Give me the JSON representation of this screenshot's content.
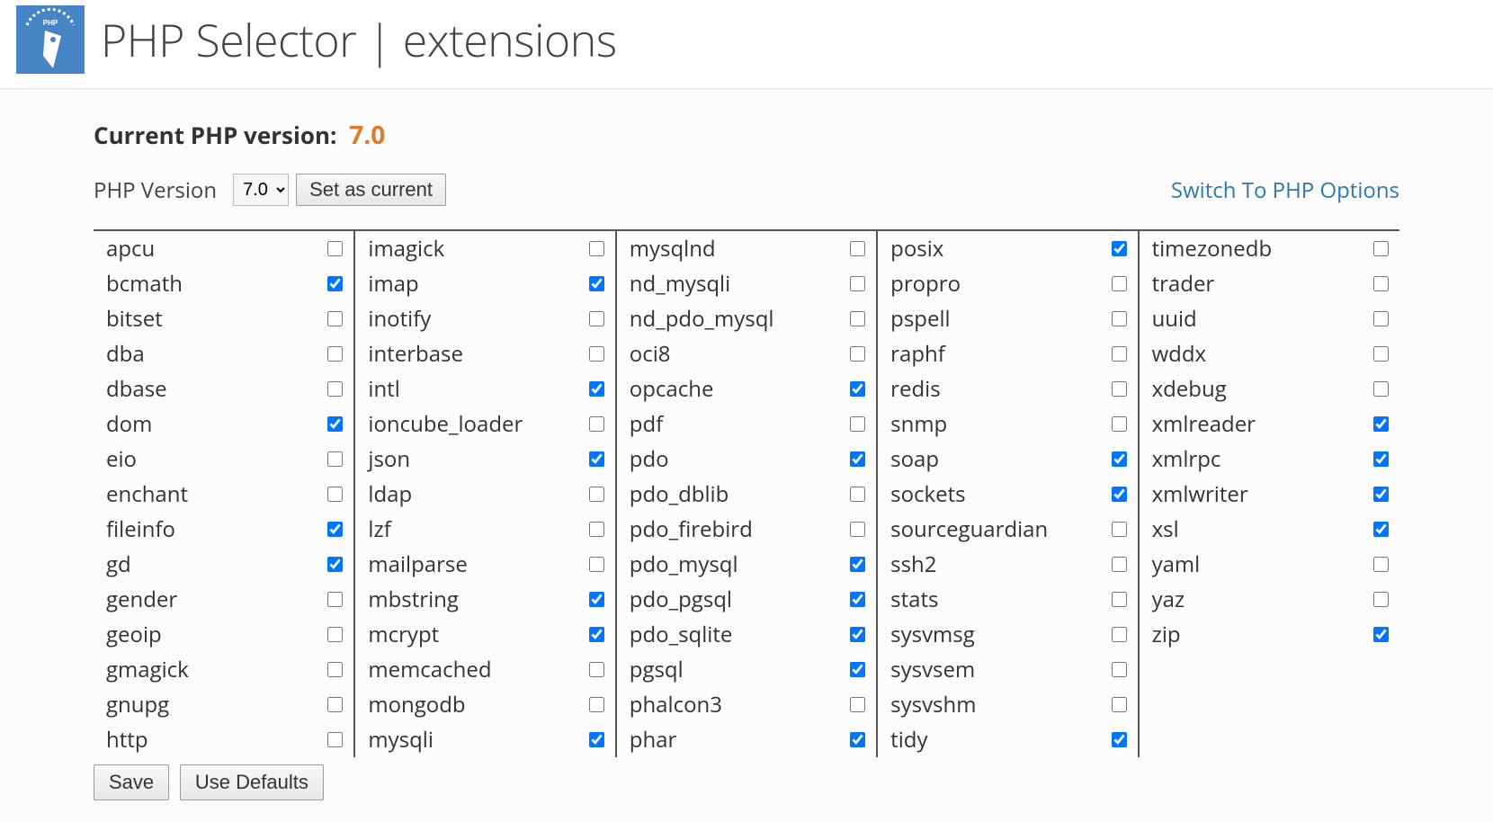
{
  "page_title": "PHP Selector | extensions",
  "version": {
    "label": "Current PHP version:",
    "value": "7.0",
    "selector_label": "PHP Version",
    "selected": "7.0",
    "set_button": "Set as current"
  },
  "options_link": "Switch To PHP Options",
  "columns": [
    [
      {
        "name": "apcu",
        "checked": false
      },
      {
        "name": "bcmath",
        "checked": true
      },
      {
        "name": "bitset",
        "checked": false
      },
      {
        "name": "dba",
        "checked": false
      },
      {
        "name": "dbase",
        "checked": false
      },
      {
        "name": "dom",
        "checked": true
      },
      {
        "name": "eio",
        "checked": false
      },
      {
        "name": "enchant",
        "checked": false
      },
      {
        "name": "fileinfo",
        "checked": true
      },
      {
        "name": "gd",
        "checked": true
      },
      {
        "name": "gender",
        "checked": false
      },
      {
        "name": "geoip",
        "checked": false
      },
      {
        "name": "gmagick",
        "checked": false
      },
      {
        "name": "gnupg",
        "checked": false
      },
      {
        "name": "http",
        "checked": false
      }
    ],
    [
      {
        "name": "imagick",
        "checked": false
      },
      {
        "name": "imap",
        "checked": true
      },
      {
        "name": "inotify",
        "checked": false
      },
      {
        "name": "interbase",
        "checked": false
      },
      {
        "name": "intl",
        "checked": true
      },
      {
        "name": "ioncube_loader",
        "checked": false
      },
      {
        "name": "json",
        "checked": true
      },
      {
        "name": "ldap",
        "checked": false
      },
      {
        "name": "lzf",
        "checked": false
      },
      {
        "name": "mailparse",
        "checked": false
      },
      {
        "name": "mbstring",
        "checked": true
      },
      {
        "name": "mcrypt",
        "checked": true
      },
      {
        "name": "memcached",
        "checked": false
      },
      {
        "name": "mongodb",
        "checked": false
      },
      {
        "name": "mysqli",
        "checked": true
      }
    ],
    [
      {
        "name": "mysqlnd",
        "checked": false
      },
      {
        "name": "nd_mysqli",
        "checked": false
      },
      {
        "name": "nd_pdo_mysql",
        "checked": false
      },
      {
        "name": "oci8",
        "checked": false
      },
      {
        "name": "opcache",
        "checked": true
      },
      {
        "name": "pdf",
        "checked": false
      },
      {
        "name": "pdo",
        "checked": true
      },
      {
        "name": "pdo_dblib",
        "checked": false
      },
      {
        "name": "pdo_firebird",
        "checked": false
      },
      {
        "name": "pdo_mysql",
        "checked": true
      },
      {
        "name": "pdo_pgsql",
        "checked": true
      },
      {
        "name": "pdo_sqlite",
        "checked": true
      },
      {
        "name": "pgsql",
        "checked": true
      },
      {
        "name": "phalcon3",
        "checked": false
      },
      {
        "name": "phar",
        "checked": true
      }
    ],
    [
      {
        "name": "posix",
        "checked": true
      },
      {
        "name": "propro",
        "checked": false
      },
      {
        "name": "pspell",
        "checked": false
      },
      {
        "name": "raphf",
        "checked": false
      },
      {
        "name": "redis",
        "checked": false
      },
      {
        "name": "snmp",
        "checked": false
      },
      {
        "name": "soap",
        "checked": true
      },
      {
        "name": "sockets",
        "checked": true
      },
      {
        "name": "sourceguardian",
        "checked": false
      },
      {
        "name": "ssh2",
        "checked": false
      },
      {
        "name": "stats",
        "checked": false
      },
      {
        "name": "sysvmsg",
        "checked": false
      },
      {
        "name": "sysvsem",
        "checked": false
      },
      {
        "name": "sysvshm",
        "checked": false
      },
      {
        "name": "tidy",
        "checked": true
      }
    ],
    [
      {
        "name": "timezonedb",
        "checked": false
      },
      {
        "name": "trader",
        "checked": false
      },
      {
        "name": "uuid",
        "checked": false
      },
      {
        "name": "wddx",
        "checked": false
      },
      {
        "name": "xdebug",
        "checked": false
      },
      {
        "name": "xmlreader",
        "checked": true
      },
      {
        "name": "xmlrpc",
        "checked": true
      },
      {
        "name": "xmlwriter",
        "checked": true
      },
      {
        "name": "xsl",
        "checked": true
      },
      {
        "name": "yaml",
        "checked": false
      },
      {
        "name": "yaz",
        "checked": false
      },
      {
        "name": "zip",
        "checked": true
      }
    ]
  ],
  "buttons": {
    "save": "Save",
    "defaults": "Use Defaults"
  }
}
